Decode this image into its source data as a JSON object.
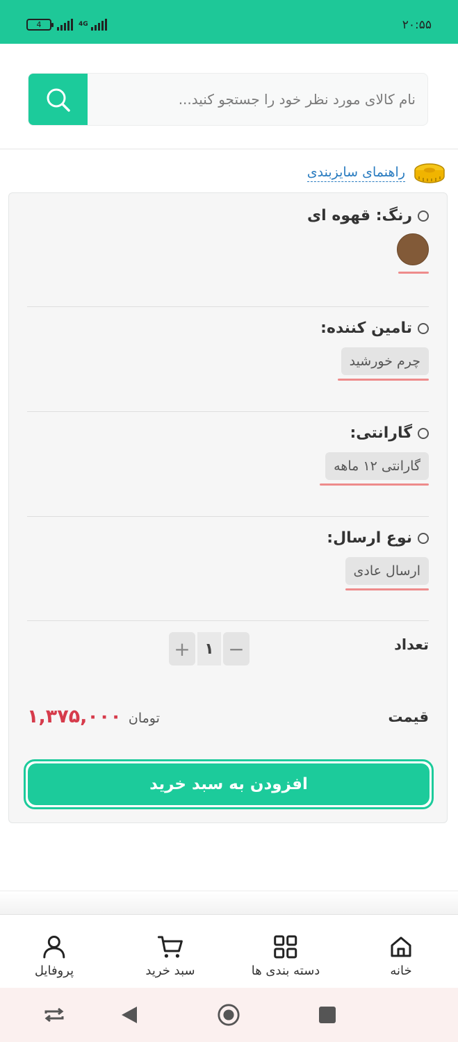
{
  "status_bar": {
    "time": "۲۰:۵۵",
    "battery_level": "4",
    "network_type": "4G"
  },
  "search": {
    "placeholder": "نام کالای مورد نظر خود را جستجو کنید...",
    "icon": "search-icon"
  },
  "size_guide": {
    "label": "راهنمای سایزبندی",
    "icon": "measuring-tape-icon"
  },
  "options": {
    "color": {
      "title": "رنگ: قهوه ای",
      "swatch_color": "#825a38"
    },
    "supplier": {
      "title": "تامین کننده:",
      "value": "چرم خورشید"
    },
    "warranty": {
      "title": "گارانتی:",
      "value": "گارانتی ۱۲ ماهه"
    },
    "shipping": {
      "title": "نوع ارسال:",
      "value": "ارسال عادی"
    }
  },
  "quantity": {
    "label": "تعداد",
    "value": "۱",
    "increase": "+",
    "decrease": "−"
  },
  "price": {
    "label": "قیمت",
    "value": "۱,۳۷۵,۰۰۰",
    "unit": "تومان"
  },
  "add_to_cart": {
    "label": "افزودن به سبد خرید"
  },
  "bottom_nav": {
    "items": [
      {
        "label": "خانه",
        "icon": "home-icon"
      },
      {
        "label": "دسته بندی ها",
        "icon": "grid-icon"
      },
      {
        "label": "سبد خرید",
        "icon": "cart-icon"
      },
      {
        "label": "پروفایل",
        "icon": "user-icon"
      }
    ]
  },
  "colors": {
    "accent": "#1ccb9b",
    "price": "#d63b4b",
    "link": "#2a7cc0",
    "underline": "#ee8b8b"
  }
}
